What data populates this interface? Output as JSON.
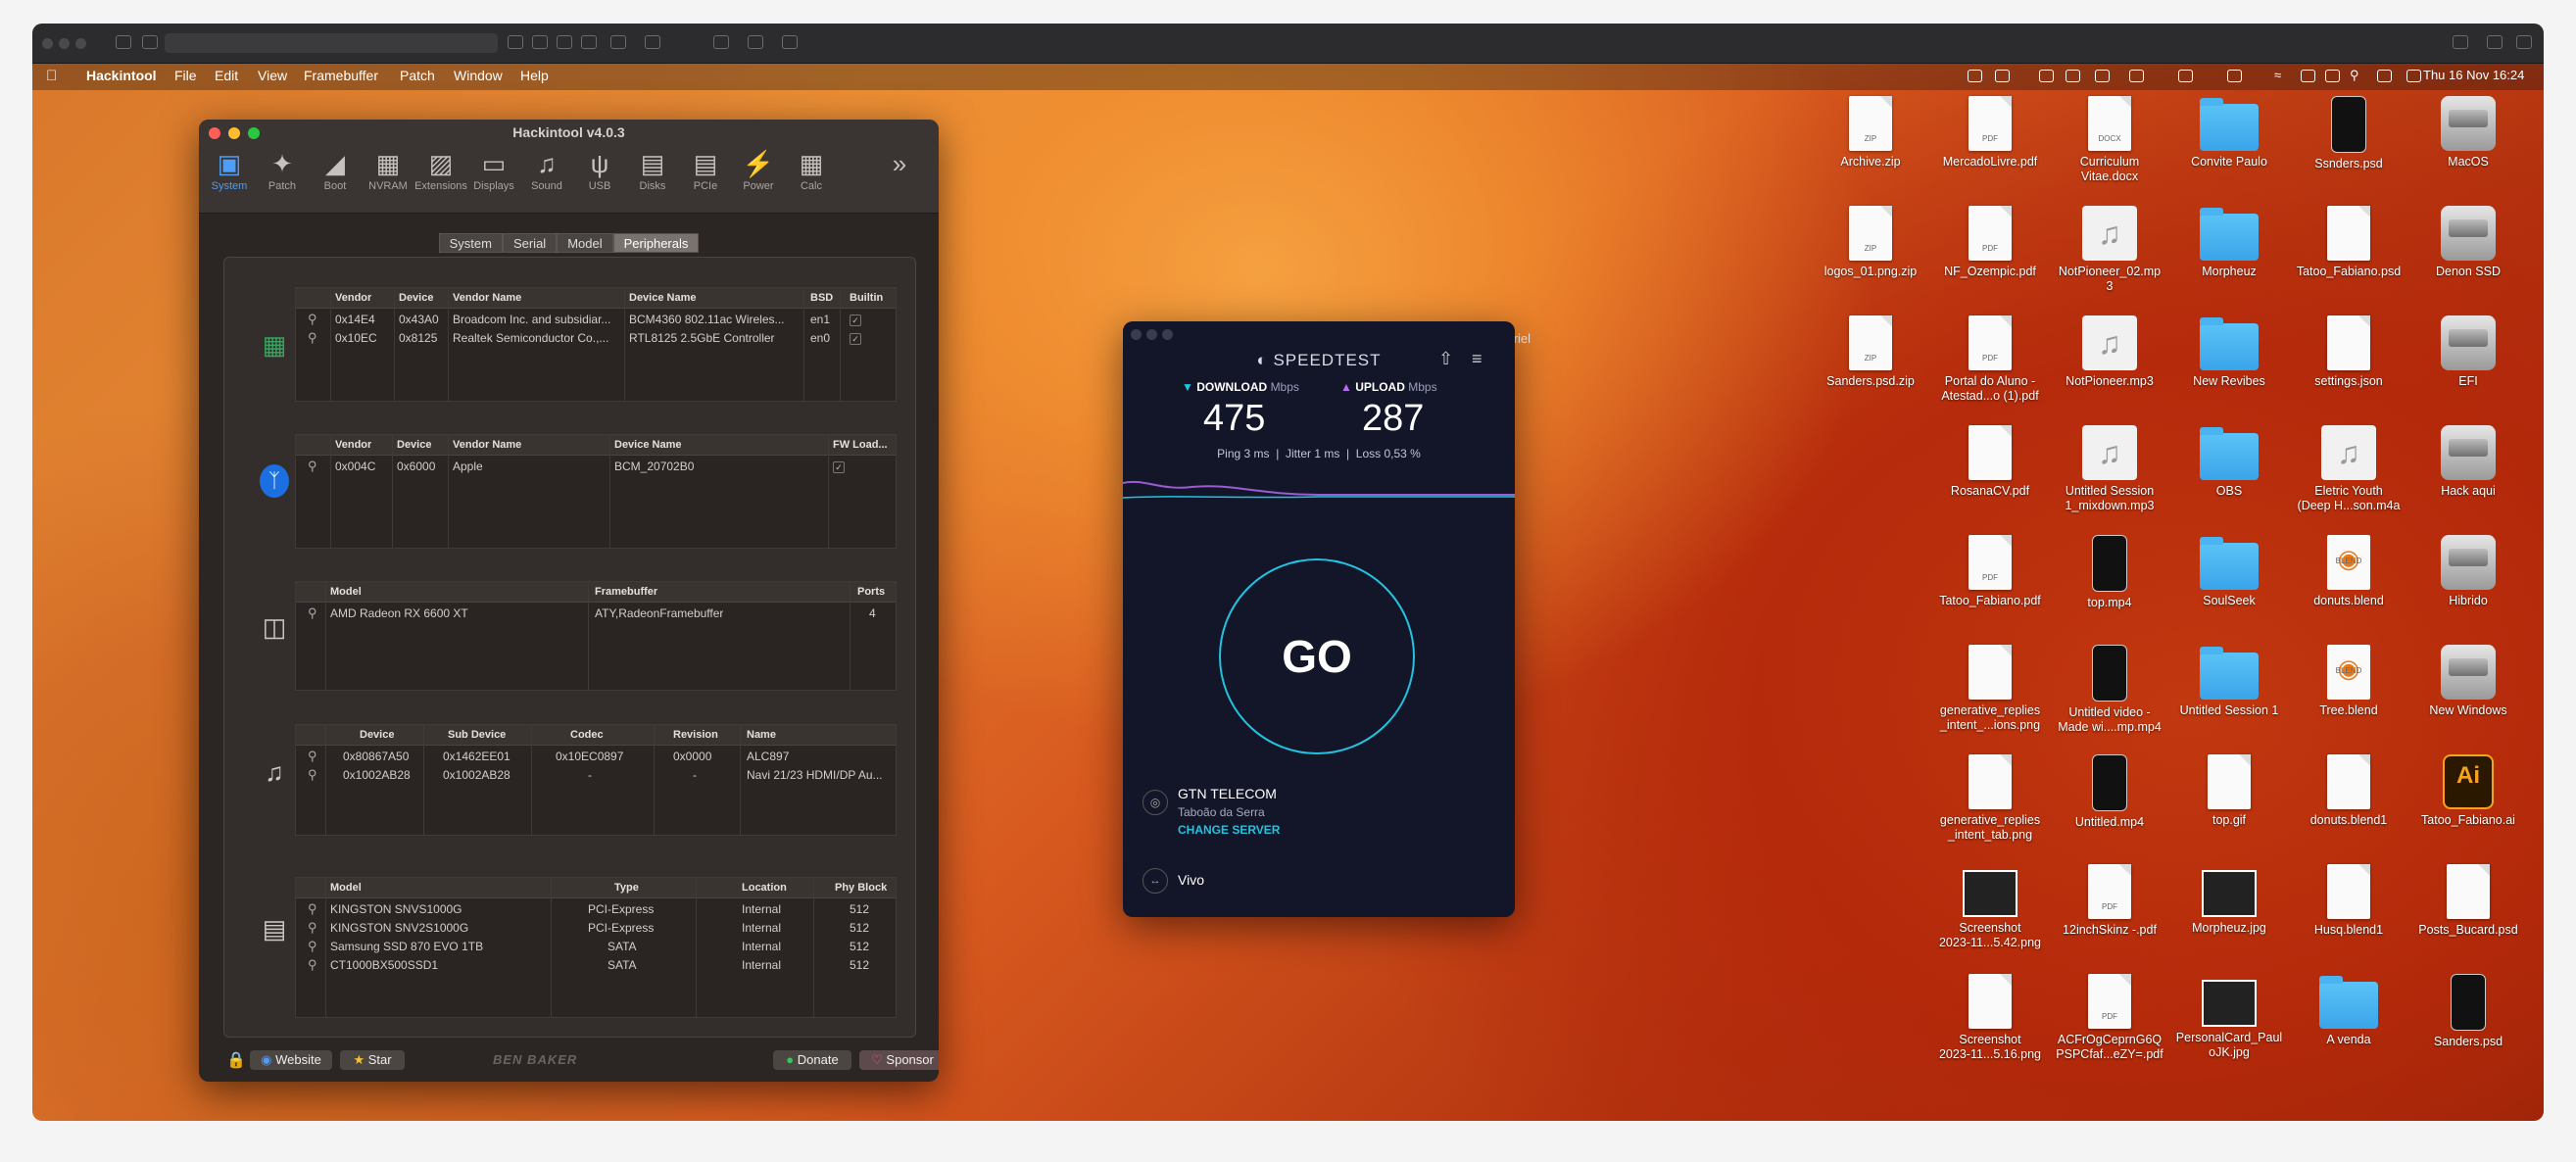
{
  "menubar": {
    "app_name": "Hackintool",
    "items": [
      "File",
      "Edit",
      "View",
      "Framebuffer",
      "Patch",
      "Window",
      "Help"
    ],
    "clock": "Thu 16 Nov  16:24"
  },
  "hackintool": {
    "title": "Hackintool v4.0.3",
    "toolbar": [
      "System",
      "Patch",
      "Boot",
      "NVRAM",
      "Extensions",
      "Displays",
      "Sound",
      "USB",
      "Disks",
      "PCIe",
      "Power",
      "Calc"
    ],
    "tabs": [
      "System",
      "Serial",
      "Model",
      "Peripherals"
    ],
    "active_tab": "Peripherals",
    "network": {
      "headers": [
        "Vendor",
        "Device",
        "Vendor Name",
        "Device Name",
        "BSD",
        "Builtin"
      ],
      "rows": [
        [
          "0x14E4",
          "0x43A0",
          "Broadcom Inc. and subsidiar...",
          "BCM4360 802.11ac Wireles...",
          "en1"
        ],
        [
          "0x10EC",
          "0x8125",
          "Realtek Semiconductor Co.,...",
          "RTL8125 2.5GbE Controller",
          "en0"
        ]
      ]
    },
    "bluetooth": {
      "headers": [
        "Vendor",
        "Device",
        "Vendor Name",
        "Device Name",
        "FW Load..."
      ],
      "rows": [
        [
          "0x004C",
          "0x6000",
          "Apple",
          "BCM_20702B0"
        ]
      ]
    },
    "gpu": {
      "headers": [
        "Model",
        "Framebuffer",
        "Ports"
      ],
      "rows": [
        [
          "AMD Radeon RX 6600 XT",
          "ATY,RadeonFramebuffer",
          "4"
        ]
      ]
    },
    "audio": {
      "headers": [
        "Device",
        "Sub Device",
        "Codec",
        "Revision",
        "Name"
      ],
      "rows": [
        [
          "0x80867A50",
          "0x1462EE01",
          "0x10EC0897",
          "0x0000",
          "ALC897"
        ],
        [
          "0x1002AB28",
          "0x1002AB28",
          "-",
          "-",
          "Navi 21/23 HDMI/DP Au..."
        ]
      ]
    },
    "storage": {
      "headers": [
        "Model",
        "Type",
        "Location",
        "Phy Block"
      ],
      "rows": [
        [
          "KINGSTON SNVS1000G",
          "PCI-Express",
          "Internal",
          "512"
        ],
        [
          "KINGSTON SNV2S1000G",
          "PCI-Express",
          "Internal",
          "512"
        ],
        [
          "Samsung SSD 870 EVO 1TB",
          "SATA",
          "Internal",
          "512"
        ],
        [
          "CT1000BX500SSD1",
          "SATA",
          "Internal",
          "512"
        ]
      ]
    },
    "footer": {
      "website": "Website",
      "star": "Star",
      "brand": "BEN BAKER",
      "donate": "Donate",
      "sponsor": "Sponsor"
    }
  },
  "speedtest": {
    "brand": "SPEEDTEST",
    "download_label": "DOWNLOAD",
    "upload_label": "UPLOAD",
    "unit": "Mbps",
    "download": "475",
    "upload": "287",
    "ping": "Ping 3 ms",
    "jitter": "Jitter 1 ms",
    "loss": "Loss 0,53 %",
    "go": "GO",
    "server_name": "GTN TELECOM",
    "server_city": "Taboão da Serra",
    "change_server": "CHANGE SERVER",
    "isp": "Vivo"
  },
  "cursor_label": "gabriel",
  "desktop_icons": [
    [
      "Archive.zip",
      "",
      "file",
      "ZIP"
    ],
    [
      "MercadoLivre.pdf",
      "",
      "file",
      "PDF"
    ],
    [
      "Curriculum",
      "Vitae.docx",
      "file",
      "DOCX"
    ],
    [
      "Convite Paulo",
      "",
      "folder",
      ""
    ],
    [
      "Ssnders.psd",
      "",
      "video",
      ""
    ],
    [
      "MacOS",
      "",
      "disk",
      ""
    ],
    [
      "logos_01.png.zip",
      "",
      "file",
      "ZIP"
    ],
    [
      "NF_Ozempic.pdf",
      "",
      "file",
      "PDF"
    ],
    [
      "NotPioneer_02.mp",
      "3",
      "audio",
      ""
    ],
    [
      "Morpheuz",
      "",
      "folder",
      ""
    ],
    [
      "Tatoo_Fabiano.psd",
      "",
      "file",
      ""
    ],
    [
      "Denon SSD",
      "",
      "disk",
      ""
    ],
    [
      "Sanders.psd.zip",
      "",
      "file",
      "ZIP"
    ],
    [
      "Portal do Aluno -",
      "Atestad...o (1).pdf",
      "file",
      "PDF"
    ],
    [
      "NotPioneer.mp3",
      "",
      "audio",
      ""
    ],
    [
      "New Revibes",
      "",
      "folder",
      ""
    ],
    [
      "settings.json",
      "",
      "file",
      ""
    ],
    [
      "EFI",
      "",
      "disk",
      ""
    ],
    [
      "",
      "",
      "",
      ""
    ],
    [
      "RosanaCV.pdf",
      "",
      "file",
      ""
    ],
    [
      "Untitled Session",
      "1_mixdown.mp3",
      "audio",
      ""
    ],
    [
      "OBS",
      "",
      "folder",
      ""
    ],
    [
      "Eletric Youth",
      "(Deep H...son.m4a",
      "audio",
      ""
    ],
    [
      "Hack aqui",
      "",
      "disk",
      ""
    ],
    [
      "",
      "",
      "",
      ""
    ],
    [
      "Tatoo_Fabiano.pdf",
      "",
      "file",
      "PDF"
    ],
    [
      "top.mp4",
      "",
      "video",
      ""
    ],
    [
      "SoulSeek",
      "",
      "folder",
      ""
    ],
    [
      "donuts.blend",
      "",
      "blend",
      "BLEND"
    ],
    [
      "Hibrido",
      "",
      "disk",
      ""
    ],
    [
      "",
      "",
      "",
      ""
    ],
    [
      "generative_replies",
      "_intent_...ions.png",
      "file",
      ""
    ],
    [
      "Untitled video -",
      "Made wi....mp.mp4",
      "video",
      ""
    ],
    [
      "Untitled Session 1",
      "",
      "folder",
      ""
    ],
    [
      "Tree.blend",
      "",
      "blend",
      "BLEND"
    ],
    [
      "New Windows",
      "",
      "disk",
      ""
    ],
    [
      "",
      "",
      "",
      ""
    ],
    [
      "generative_replies",
      "_intent_tab.png",
      "file",
      ""
    ],
    [
      "Untitled.mp4",
      "",
      "video",
      ""
    ],
    [
      "top.gif",
      "",
      "file",
      ""
    ],
    [
      "donuts.blend1",
      "",
      "file",
      ""
    ],
    [
      "Tatoo_Fabiano.ai",
      "",
      "ai",
      ""
    ],
    [
      "",
      "",
      "",
      ""
    ],
    [
      "Screenshot",
      "2023-11...5.42.png",
      "img",
      ""
    ],
    [
      "12inchSkinz -.pdf",
      "",
      "file",
      "PDF"
    ],
    [
      "Morpheuz.jpg",
      "",
      "img",
      ""
    ],
    [
      "Husq.blend1",
      "",
      "file",
      ""
    ],
    [
      "Posts_Bucard.psd",
      "",
      "file",
      ""
    ],
    [
      "",
      "",
      "",
      ""
    ],
    [
      "Screenshot",
      "2023-11...5.16.png",
      "file",
      ""
    ],
    [
      "ACFrOgCeprnG6Q",
      "PSPCfaf...eZY=.pdf",
      "file",
      "PDF"
    ],
    [
      "PersonalCard_Paul",
      "oJK.jpg",
      "img",
      ""
    ],
    [
      "A venda",
      "",
      "folder",
      ""
    ],
    [
      "Sanders.psd",
      "",
      "video",
      ""
    ]
  ]
}
